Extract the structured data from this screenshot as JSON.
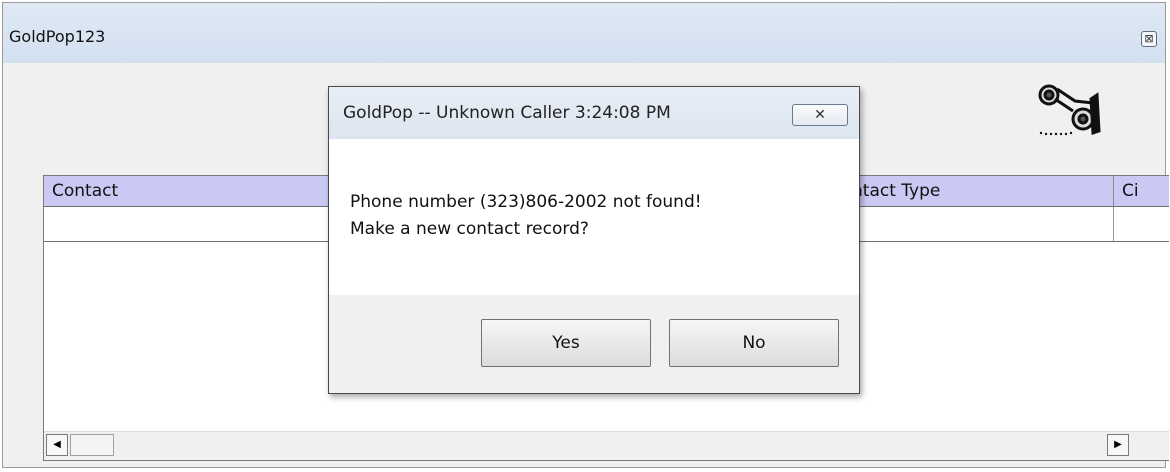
{
  "window": {
    "title": "GoldPop123",
    "close_glyph": "⊠"
  },
  "icons": {
    "app_icon": "phone-handset-icon",
    "window_close": "close-icon",
    "scroll_left": "arrow-left-icon",
    "scroll_right": "arrow-right-icon"
  },
  "grid": {
    "columns": [
      "Contact",
      "ntact Type",
      "Ci"
    ],
    "header_color": "#c9c9f3"
  },
  "scrollbar": {
    "left_arrow": "◀",
    "right_arrow": "▶"
  },
  "dialog": {
    "title": "GoldPop -- Unknown Caller 3:24:08 PM",
    "close_glyph": "✕",
    "message_line1": "Phone number (323)806-2002 not found!",
    "message_line2": "Make a new contact record?",
    "yes_label": "Yes",
    "no_label": "No"
  }
}
